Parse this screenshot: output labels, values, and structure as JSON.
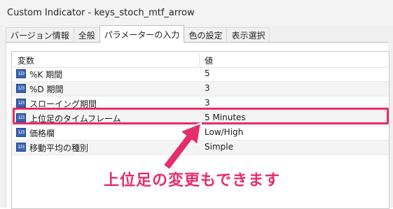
{
  "window": {
    "title": "Custom Indicator - keys_stoch_mtf_arrow"
  },
  "tabs": [
    {
      "label": "バージョン情報",
      "active": false
    },
    {
      "label": "全般",
      "active": false
    },
    {
      "label": "パラメーターの入力",
      "active": true
    },
    {
      "label": "色の設定",
      "active": false
    },
    {
      "label": "表示選択",
      "active": false
    }
  ],
  "grid": {
    "headers": {
      "variable": "変数",
      "value": "値"
    },
    "icon_text": "123",
    "rows": [
      {
        "name": "%K 期間",
        "value": "5"
      },
      {
        "name": "%D 期間",
        "value": "3"
      },
      {
        "name": "スローイング期間",
        "value": "3"
      },
      {
        "name": "上位足のタイムフレーム",
        "value": "5 Minutes"
      },
      {
        "name": "価格欄",
        "value": "Low/High"
      },
      {
        "name": "移動平均の種別",
        "value": "Simple"
      }
    ]
  },
  "annotation": {
    "caption": "上位足の変更もできます",
    "color": "#e52d6c"
  }
}
